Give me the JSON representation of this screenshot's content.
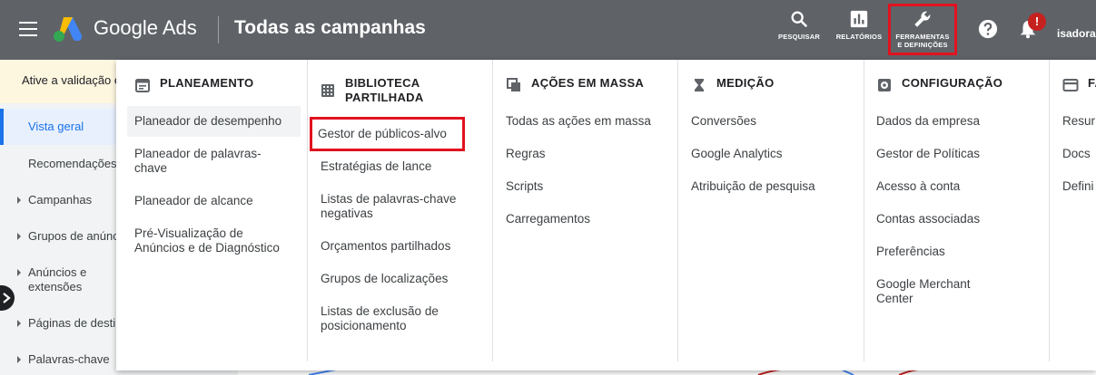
{
  "header": {
    "brand": "Google Ads",
    "page_title": "Todas as campanhas",
    "tools": {
      "search_label": "PESQUISAR",
      "reports_label": "RELATÓRIOS",
      "tools_label_line1": "FERRAMENTAS",
      "tools_label_line2": "E DEFINIÇÕES"
    },
    "notification_badge": "!",
    "user": "isadorag"
  },
  "banner": {
    "text": "Ative a validação e"
  },
  "sidebar": {
    "items": [
      {
        "label": "Vista geral",
        "active": true
      },
      {
        "label": "Recomendações"
      },
      {
        "label": "Campanhas"
      },
      {
        "label": "Grupos de anúnc"
      },
      {
        "label": "Anúncios e extensões"
      },
      {
        "label": "Páginas de destin"
      },
      {
        "label": "Palavras-chave"
      }
    ]
  },
  "menu": {
    "columns": [
      {
        "title": "PLANEAMENTO",
        "icon": "calendar-icon",
        "items": [
          "Planeador de desempenho",
          "Planeador de palavras-chave",
          "Planeador de alcance",
          "Pré-Visualização de Anúncios e de Diagnóstico"
        ]
      },
      {
        "title": "BIBLIOTECA PARTILHADA",
        "icon": "grid-library-icon",
        "items": [
          "Gestor de públicos-alvo",
          "Estratégias de lance",
          "Listas de palavras-chave negativas",
          "Orçamentos partilhados",
          "Grupos de localizações",
          "Listas de exclusão de posicionamento"
        ]
      },
      {
        "title": "AÇÕES EM MASSA",
        "icon": "copy-stack-icon",
        "items": [
          "Todas as ações em massa",
          "Regras",
          "Scripts",
          "Carregamentos"
        ]
      },
      {
        "title": "MEDIÇÃO",
        "icon": "hourglass-icon",
        "items": [
          "Conversões",
          "Google Analytics",
          "Atribuição de pesquisa"
        ]
      },
      {
        "title": "CONFIGURAÇÃO",
        "icon": "settings-cog-icon",
        "items": [
          "Dados da empresa",
          "Gestor de Políticas",
          "Acesso à conta",
          "Contas associadas",
          "Preferências",
          "Google Merchant Center"
        ]
      },
      {
        "title": "FA",
        "icon": "card-icon",
        "items": [
          "Resur",
          "Docs",
          "Defini"
        ]
      }
    ]
  },
  "colors": {
    "topbar": "#5f6368",
    "highlight_box": "#e1121f",
    "active_nav": "#1a73e8"
  }
}
